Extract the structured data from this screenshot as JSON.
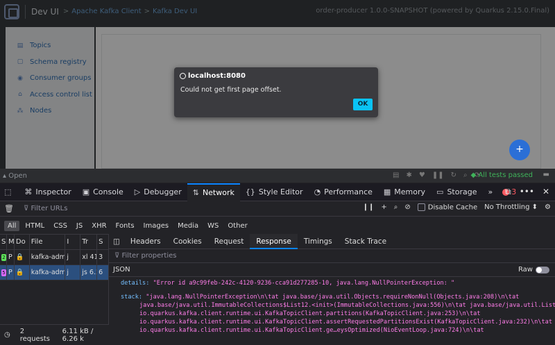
{
  "devui": {
    "title": "Dev UI",
    "breadcrumbs": [
      "Apache Kafka Client",
      "Kafka Dev UI"
    ],
    "crumb_sep": ">",
    "extension_info": "order-producer 1.0.0-SNAPSHOT (powered by Quarkus 2.15.0.Final)",
    "sidebar": [
      {
        "label": "Topics",
        "icon": "topics-icon"
      },
      {
        "label": "Schema registry",
        "icon": "schema-icon"
      },
      {
        "label": "Consumer groups",
        "icon": "consumers-icon"
      },
      {
        "label": "Access control list",
        "icon": "acl-icon"
      },
      {
        "label": "Nodes",
        "icon": "nodes-icon"
      }
    ],
    "fab_label": "+",
    "footer": {
      "open_label": "Open",
      "tests_label": "All tests passed"
    }
  },
  "dialog": {
    "origin": "localhost:8080",
    "message": "Could not get first page offset.",
    "ok_label": "OK"
  },
  "devtools": {
    "tabs": [
      {
        "label": "Inspector",
        "icon": "inspector-icon"
      },
      {
        "label": "Console",
        "icon": "console-icon"
      },
      {
        "label": "Debugger",
        "icon": "debugger-icon"
      },
      {
        "label": "Network",
        "icon": "network-icon",
        "active": true
      },
      {
        "label": "Style Editor",
        "icon": "style-editor-icon"
      },
      {
        "label": "Performance",
        "icon": "performance-icon"
      },
      {
        "label": "Memory",
        "icon": "memory-icon"
      },
      {
        "label": "Storage",
        "icon": "storage-icon"
      }
    ],
    "error_count": "3",
    "filter_placeholder": "Filter URLs",
    "disable_cache_label": "Disable Cache",
    "throttling_label": "No Throttling",
    "type_filters": [
      "All",
      "HTML",
      "CSS",
      "JS",
      "XHR",
      "Fonts",
      "Images",
      "Media",
      "WS",
      "Other"
    ],
    "selected_type": "All",
    "table_headers": [
      "S",
      "M",
      "Do",
      "File",
      "I",
      "Tr",
      "S"
    ],
    "requests": [
      {
        "status": "2",
        "status_color": "#5ee35a",
        "method": "P",
        "domain": "",
        "file": "kafka-admir",
        "initiator": "j",
        "type": "xl",
        "transferred": "41 B",
        "size": "3"
      },
      {
        "status": "5",
        "status_color": "#d86aff",
        "method": "P",
        "domain": "",
        "file": "kafka-admir",
        "initiator": "j",
        "type": "js",
        "transferred": "6.22",
        "size": "6"
      }
    ],
    "detail_tabs": [
      "Headers",
      "Cookies",
      "Request",
      "Response",
      "Timings",
      "Stack Trace"
    ],
    "active_detail_tab": "Response",
    "filter_props_placeholder": "Filter properties",
    "json_label": "JSON",
    "raw_label": "Raw",
    "response": {
      "details_key": "details:",
      "details_val": "\"Error id a9c99feb-242c-4120-9236-cca91d277285-10, java.lang.NullPointerException: \"",
      "stack_key": "stack:",
      "stack_lines": [
        "\"java.lang.NullPointerException\\n\\tat java.base/java.util.Objects.requireNonNull(Objects.java:208)\\n\\tat",
        "java.base/java.util.ImmutableCollections$List12.<init>(ImmutableCollections.java:556)\\n\\tat java.base/java.util.List.of(List.java:812)\\n\\tat",
        "io.quarkus.kafka.client.runtime.ui.KafkaTopicClient.partitions(KafkaTopicClient.java:253)\\n\\tat",
        "io.quarkus.kafka.client.runtime.ui.KafkaTopicClient.assertRequestedPartitionsExist(KafkaTopicClient.java:232)\\n\\tat",
        "io.quarkus.kafka.client.runtime.ui.KafkaTopicClient.ge…eysOptimized(NioEventLoop.java:724)\\n\\tat"
      ]
    },
    "status": {
      "requests": "2 requests",
      "size": "6.11 kB / 6.26 k"
    }
  }
}
